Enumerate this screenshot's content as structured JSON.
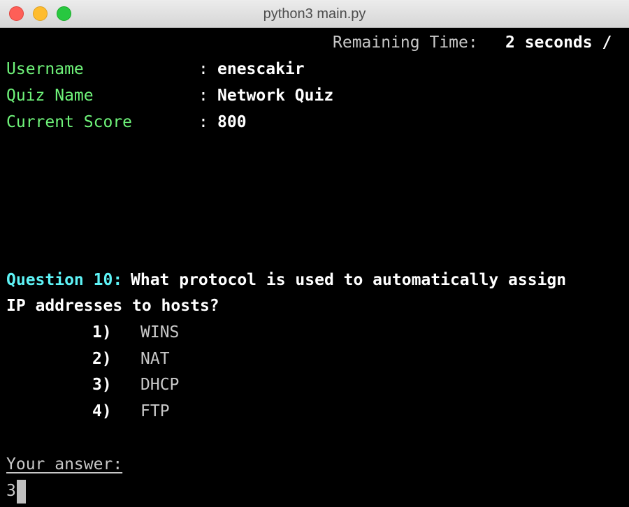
{
  "window": {
    "title": "python3 main.py"
  },
  "timer": {
    "label": "Remaining Time:",
    "value": "2 seconds /"
  },
  "info": {
    "username_label": "Username",
    "username_value": "enescakir",
    "quiz_label": "Quiz Name",
    "quiz_value": "Network Quiz",
    "score_label": "Current Score",
    "score_value": "800",
    "separator": ":"
  },
  "question": {
    "number_label": "Question 10:",
    "text_line1": "What protocol is used to automatically assign",
    "text_line2": "IP addresses to hosts?",
    "options": [
      {
        "num": "1)",
        "text": "WINS"
      },
      {
        "num": "2)",
        "text": "NAT"
      },
      {
        "num": "3)",
        "text": "DHCP"
      },
      {
        "num": "4)",
        "text": "FTP"
      }
    ]
  },
  "answer": {
    "prompt": "Your answer:",
    "input_value": "3"
  },
  "colors": {
    "label_green": "#6ff47a",
    "question_cyan": "#5ef3f6",
    "background": "#000000"
  }
}
